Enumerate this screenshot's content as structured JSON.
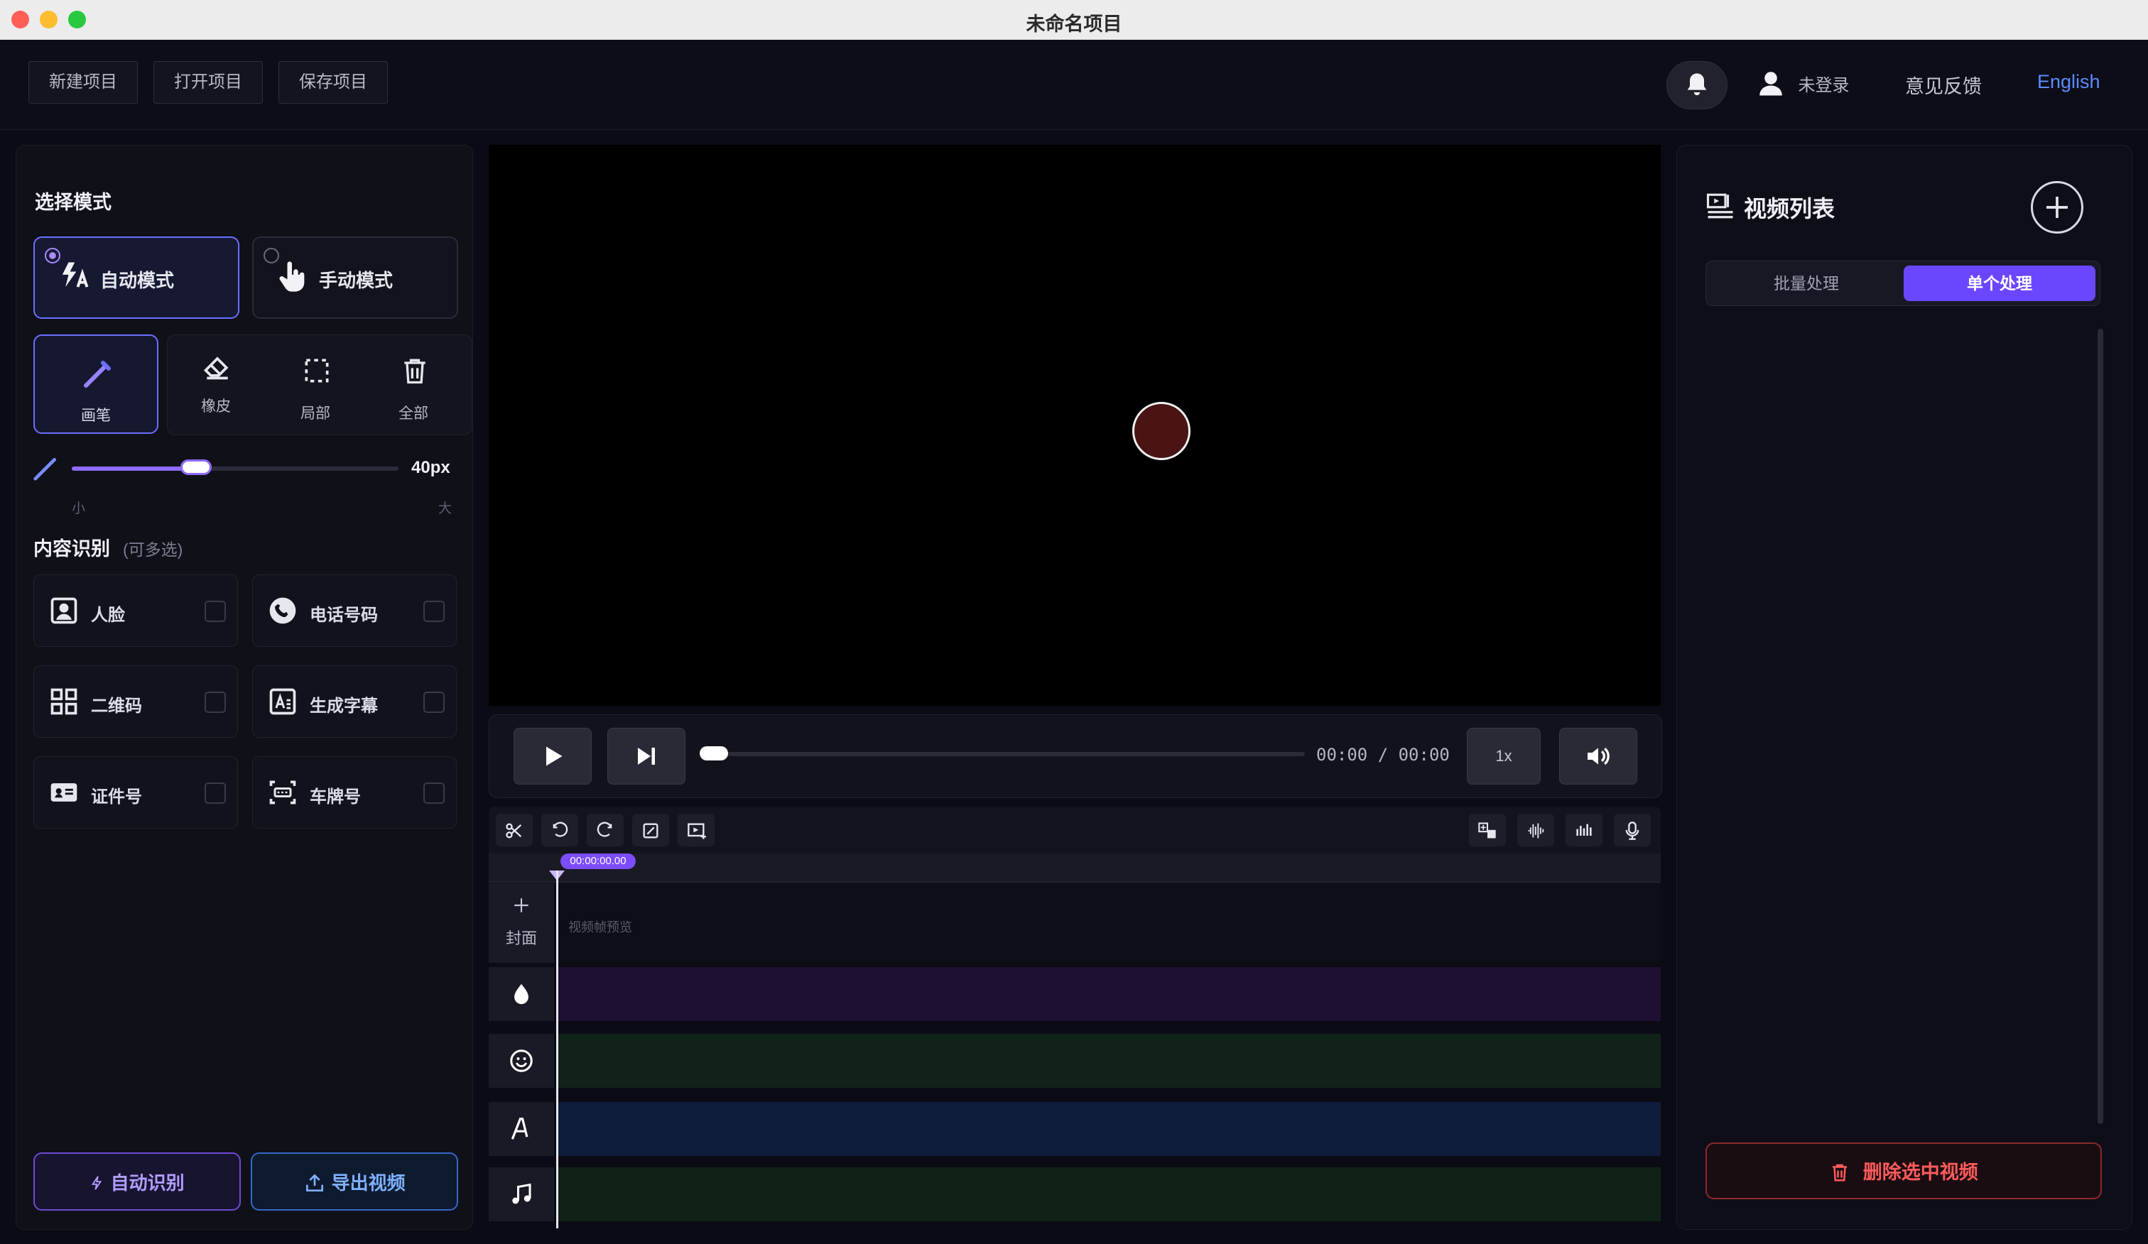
{
  "window": {
    "title": "未命名项目"
  },
  "toolbar": {
    "new_project": "新建项目",
    "open_project": "打开项目",
    "save_project": "保存项目",
    "user_status": "未登录",
    "feedback": "意见反馈",
    "language": "English"
  },
  "left": {
    "mode_title": "选择模式",
    "auto_mode": "自动模式",
    "manual_mode": "手动模式",
    "tools": {
      "pen": "画笔",
      "eraser": "橡皮",
      "partial": "局部",
      "all": "全部"
    },
    "brush": {
      "value_label": "40px",
      "min_label": "小",
      "max_label": "大",
      "level_fraction": 0.38
    },
    "content_title": "内容识别",
    "content_sub": "(可多选)",
    "content_items": {
      "face": "人脸",
      "phone": "电话号码",
      "qrcode": "二维码",
      "subtitle": "生成字幕",
      "id_number": "证件号",
      "plate": "车牌号"
    },
    "auto_detect": "自动识别",
    "export_video": "导出视频"
  },
  "player": {
    "time": "00:00 / 00:00",
    "speed": "1x"
  },
  "timeline": {
    "playhead_time": "00:00:00.00",
    "cover_label": "封面",
    "frames_placeholder": "视频帧预览",
    "track_colors": {
      "blur": "#1e1033",
      "sticker": "#112219",
      "text": "#101c3c",
      "music": "#102216"
    }
  },
  "right": {
    "title": "视频列表",
    "batch": "批量处理",
    "single": "单个处理",
    "delete_selected": "删除选中视频"
  },
  "colors": {
    "accent_purple": "#6b46ff",
    "accent_blue": "#3568c8",
    "danger": "#ff5a5a"
  }
}
